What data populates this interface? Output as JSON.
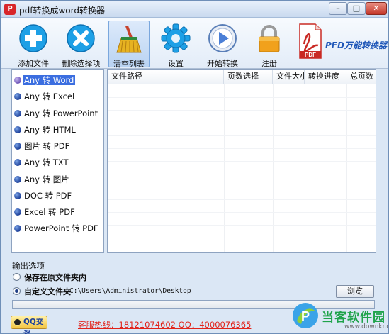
{
  "window": {
    "title": "pdf转换成word转换器",
    "app_icon_glyph": "P"
  },
  "toolbar": [
    {
      "label": "添加文件",
      "icon": "plus-icon",
      "color": "#1ea0e6"
    },
    {
      "label": "删除选择项",
      "icon": "delete-x-icon",
      "color": "#1ea0e6"
    },
    {
      "label": "清空列表",
      "icon": "broom-icon",
      "color": "#e6b221"
    },
    {
      "label": "设置",
      "icon": "gear-icon",
      "color": "#1ea0e6"
    },
    {
      "label": "开始转换",
      "icon": "play-icon",
      "color": "#4b7fd6"
    },
    {
      "label": "注册",
      "icon": "lock-icon",
      "color": "#f1a11c"
    }
  ],
  "brand": {
    "label": "PFD万能转换器",
    "pdf_text": "PDF"
  },
  "sidebar": {
    "items": [
      {
        "label": "Any 转 Word",
        "selected": true
      },
      {
        "label": "Any 转 Excel",
        "selected": false
      },
      {
        "label": "Any 转 PowerPoint",
        "selected": false
      },
      {
        "label": "Any 转 HTML",
        "selected": false
      },
      {
        "label": "图片 转 PDF",
        "selected": false
      },
      {
        "label": "Any 转 TXT",
        "selected": false
      },
      {
        "label": "Any 转 图片",
        "selected": false
      },
      {
        "label": "DOC 转 PDF",
        "selected": false
      },
      {
        "label": "Excel 转 PDF",
        "selected": false
      },
      {
        "label": "PowerPoint 转 PDF",
        "selected": false
      }
    ]
  },
  "table": {
    "columns": [
      "文件路径",
      "页数选择",
      "文件大小",
      "转换进度",
      "总页数"
    ],
    "rows": []
  },
  "output": {
    "title": "输出选项",
    "option_original": "保存在原文件夹内",
    "option_custom": "自定义文件夹",
    "custom_selected": true,
    "path": "C:\\Users\\Administrator\\Desktop",
    "browse_label": "浏览"
  },
  "progress": {
    "value": 0
  },
  "footer": {
    "qq_label": "QQ交谈",
    "hotline": "客服热线：18121074602 QQ：4000076365"
  },
  "watermark": {
    "text": "当客软件园",
    "url": "www.downkr.com"
  }
}
